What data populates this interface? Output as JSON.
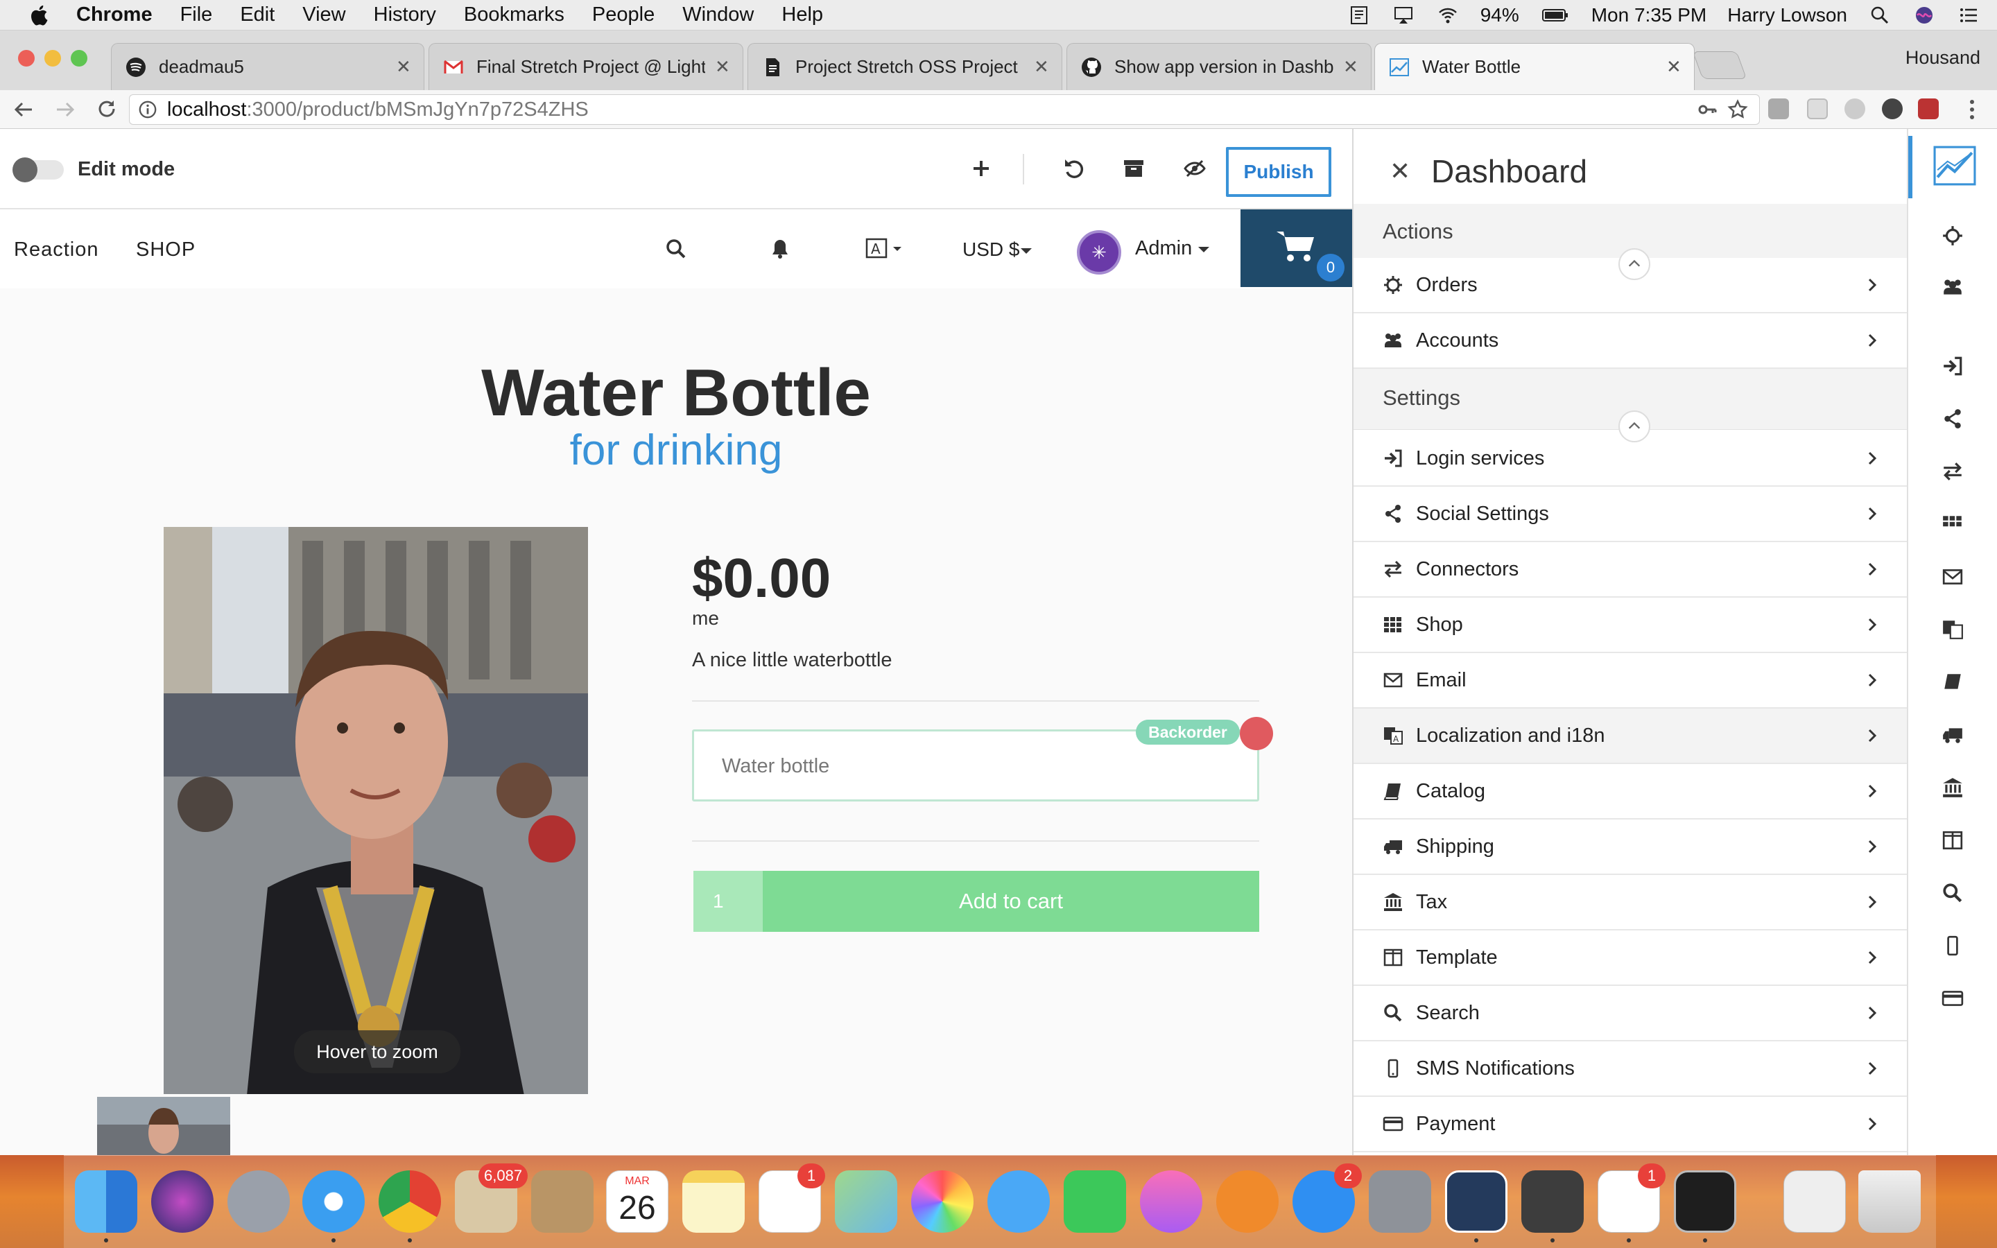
{
  "menubar": {
    "app": "Chrome",
    "items": [
      "File",
      "Edit",
      "View",
      "History",
      "Bookmarks",
      "People",
      "Window",
      "Help"
    ],
    "battery": "94%",
    "clock": "Mon 7:35 PM",
    "user": "Harry Lowson"
  },
  "tabs": [
    {
      "title": "deadmau5",
      "icon": "spotify-icon"
    },
    {
      "title": "Final Stretch Project @ Lighthouse",
      "icon": "gmail-icon"
    },
    {
      "title": "Project Stretch OSS Project List",
      "icon": "document-icon"
    },
    {
      "title": "Show app version in Dashboard",
      "icon": "github-icon"
    },
    {
      "title": "Water Bottle",
      "icon": "chart-icon",
      "active": true
    }
  ],
  "profile_name": "Housand",
  "address": {
    "host": "localhost",
    "path": ":3000/product/bMSmJgYn7p72S4ZHS"
  },
  "admin_toolbar": {
    "edit_mode_label": "Edit mode",
    "publish_label": "Publish"
  },
  "storefront": {
    "brand": "Reaction",
    "shop_link": "SHOP",
    "currency": "USD $",
    "admin_label": "Admin",
    "avatar_glyph": "✳",
    "cart_count": "0"
  },
  "product": {
    "title": "Water Bottle",
    "subtitle": "for drinking",
    "price": "$0.00",
    "vendor": "me",
    "description": "A nice little waterbottle",
    "variant_label": "Water bottle",
    "variant_badge": "Backorder",
    "quantity": "1",
    "add_to_cart": "Add to cart",
    "zoom_hint": "Hover to zoom"
  },
  "dashboard": {
    "title": "Dashboard",
    "groups": [
      {
        "label": "Actions",
        "items": [
          {
            "label": "Orders",
            "icon": "gear-icon"
          },
          {
            "label": "Accounts",
            "icon": "users-icon"
          }
        ]
      },
      {
        "label": "Settings",
        "items": [
          {
            "label": "Login services",
            "icon": "sign-in-icon"
          },
          {
            "label": "Social Settings",
            "icon": "share-icon"
          },
          {
            "label": "Connectors",
            "icon": "exchange-icon"
          },
          {
            "label": "Shop",
            "icon": "grid-icon"
          },
          {
            "label": "Email",
            "icon": "envelope-icon"
          },
          {
            "label": "Localization and i18n",
            "icon": "translate-icon",
            "highlight": true
          },
          {
            "label": "Catalog",
            "icon": "book-icon"
          },
          {
            "label": "Shipping",
            "icon": "truck-icon"
          },
          {
            "label": "Tax",
            "icon": "bank-icon"
          },
          {
            "label": "Template",
            "icon": "columns-icon"
          },
          {
            "label": "Search",
            "icon": "search-icon"
          },
          {
            "label": "SMS Notifications",
            "icon": "mobile-icon"
          },
          {
            "label": "Payment",
            "icon": "credit-card-icon"
          }
        ]
      }
    ]
  },
  "dock": {
    "mail_badge": "6,087",
    "calendar_month": "MAR",
    "calendar_day": "26",
    "reminders_badge": "1",
    "appstore_badge": "2",
    "slack_badge": "1"
  },
  "colors": {
    "accent": "#3a93d8",
    "add_to_cart": "#7edb94",
    "cart_box": "#1f4a6a",
    "backorder": "#86d7b7",
    "dock": "#e6842f"
  }
}
